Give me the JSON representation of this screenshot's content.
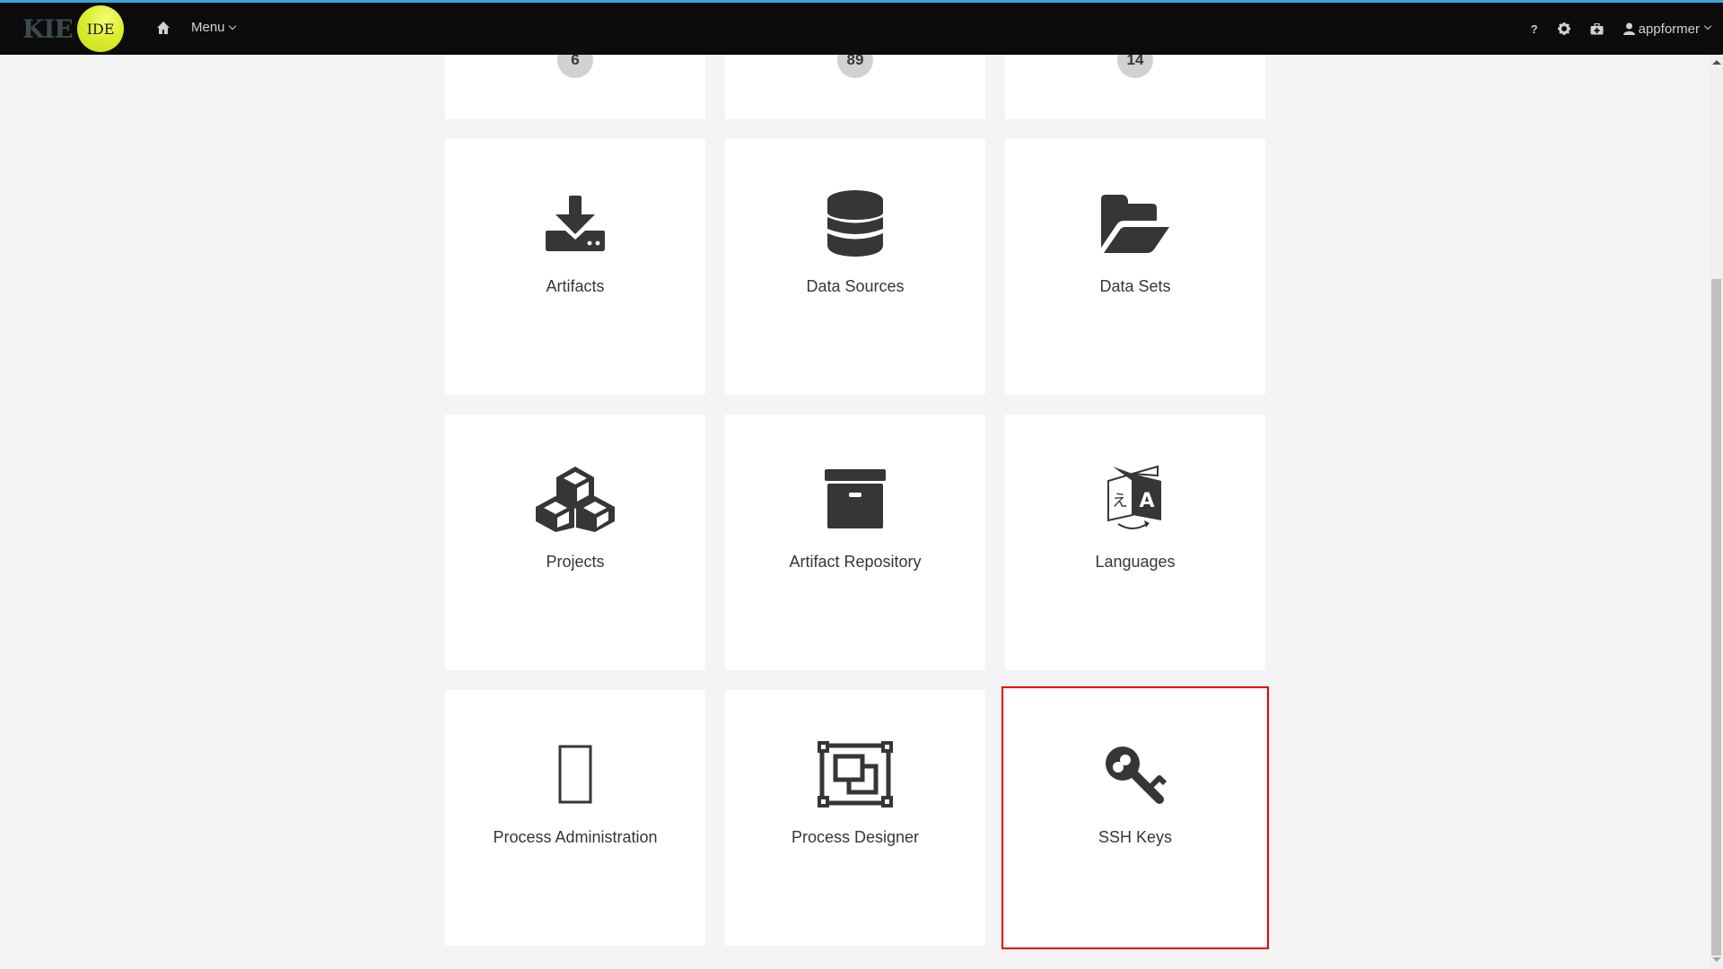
{
  "header": {
    "logo_text": "KIE",
    "logo_badge": "IDE",
    "home_icon": "home-icon",
    "menu_label": "Menu",
    "help_label": "?",
    "settings_icon": "gear-icon",
    "tasks_icon": "briefcase-icon",
    "user_label": "appformer"
  },
  "colors": {
    "accent": "#39a5dc",
    "navbar": "#0c0c0c",
    "logo_ball": "#dced2c",
    "selection": "#ee0000",
    "icon": "#363636",
    "background": "#f4f4f4"
  },
  "top_row_counts": [
    "6",
    "89",
    "14"
  ],
  "tiles": [
    {
      "label": "Artifacts",
      "icon": "download-icon"
    },
    {
      "label": "Data Sources",
      "icon": "database-icon"
    },
    {
      "label": "Data Sets",
      "icon": "folder-open-icon"
    },
    {
      "label": "Projects",
      "icon": "cubes-icon"
    },
    {
      "label": "Artifact Repository",
      "icon": "archive-box-icon"
    },
    {
      "label": "Languages",
      "icon": "language-icon"
    },
    {
      "label": "Process Administration",
      "icon": "missing-glyph-icon"
    },
    {
      "label": "Process Designer",
      "icon": "object-group-icon"
    },
    {
      "label": "SSH Keys",
      "icon": "key-icon",
      "selected": true
    }
  ]
}
